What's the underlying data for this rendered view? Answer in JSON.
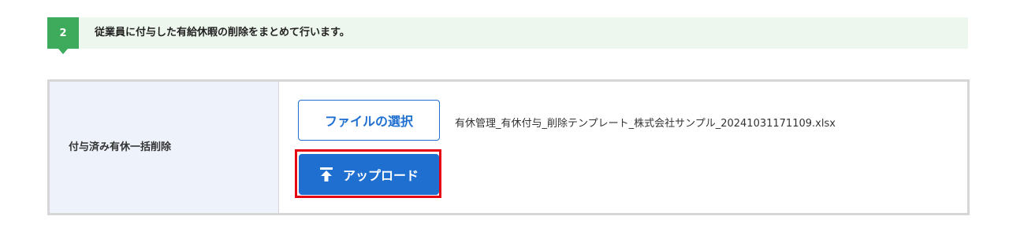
{
  "step": {
    "number": "2",
    "description": "従業員に付与した有給休暇の削除をまとめて行います。",
    "accent_color": "#3daa5c"
  },
  "form": {
    "row_label": "付与済み有休一括削除",
    "file_select_label": "ファイルの選択",
    "selected_file_name": "有休管理_有休付与_削除テンプレート_株式会社サンプル_20241031171109.xlsx",
    "upload_label": "アップロード",
    "upload_icon": "upload-icon",
    "button_color": "#1f6fd1",
    "highlight_color": "#e60012"
  }
}
